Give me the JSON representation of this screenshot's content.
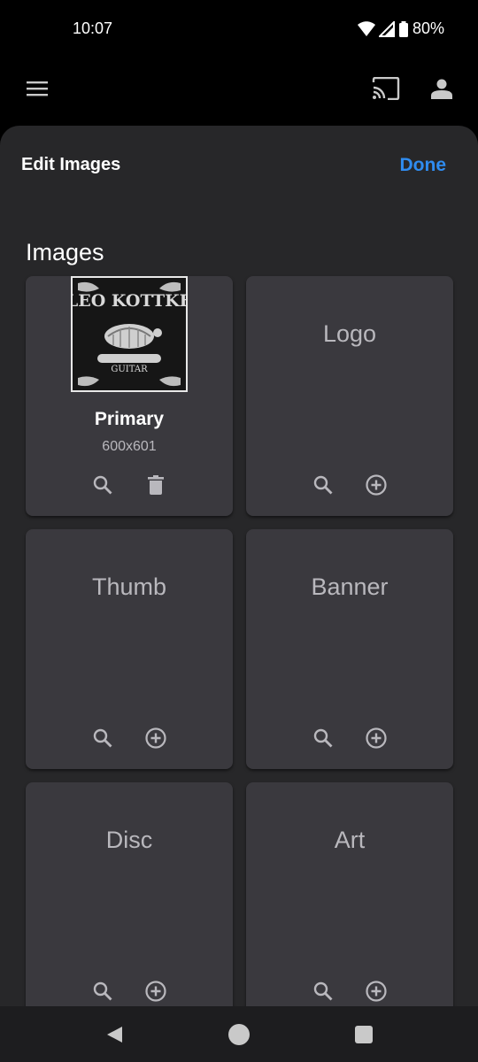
{
  "status": {
    "time": "10:07",
    "battery": "80%"
  },
  "sheet": {
    "title": "Edit Images",
    "done_label": "Done"
  },
  "section_title": "Images",
  "primary": {
    "title": "Primary",
    "size": "600x601",
    "image_alt": "LEO KOTTKE"
  },
  "cards": [
    {
      "label": "Logo"
    },
    {
      "label": "Thumb"
    },
    {
      "label": "Banner"
    },
    {
      "label": "Disc"
    },
    {
      "label": "Art"
    }
  ],
  "icons": {
    "menu": "menu-icon",
    "cast": "cast-icon",
    "account": "account-icon",
    "search": "search-icon",
    "delete": "delete-icon",
    "add": "add-circle-icon",
    "back": "back-icon",
    "home": "home-icon",
    "recents": "recents-icon"
  },
  "colors": {
    "accent": "#2f8cf0",
    "sheet": "#272729",
    "card": "#3a393e",
    "muted_text": "#b9b8bd"
  }
}
